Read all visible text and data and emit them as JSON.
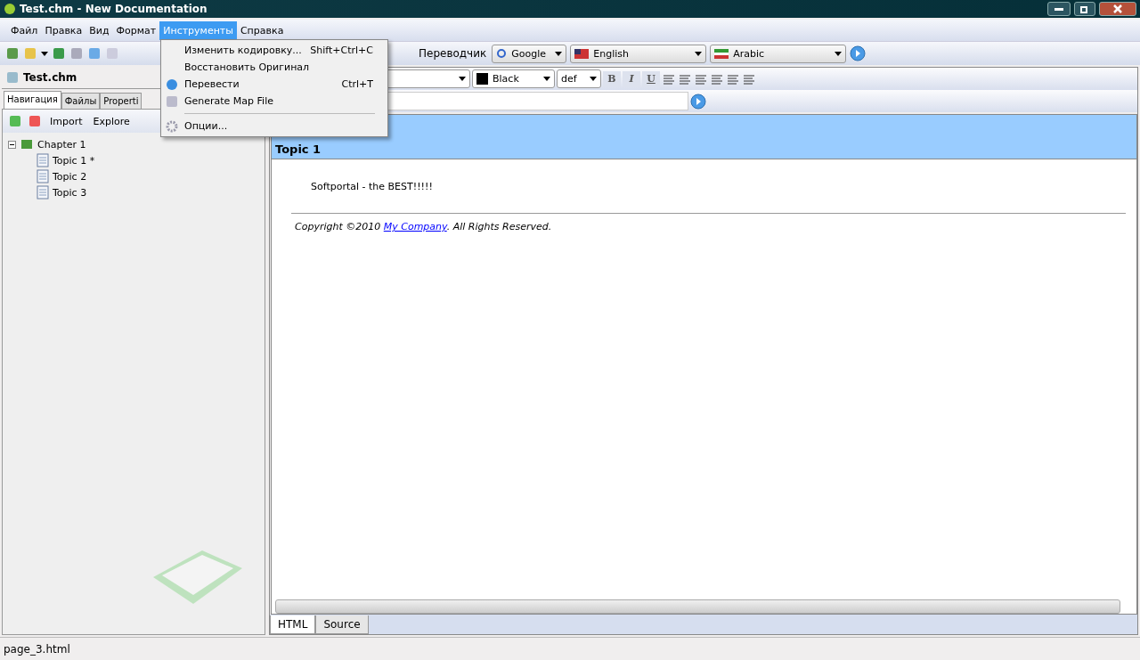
{
  "window": {
    "title": "Test.chm - New Documentation"
  },
  "menu_bar": [
    {
      "label": "Файл",
      "selected": false
    },
    {
      "label": "Правка",
      "selected": false
    },
    {
      "label": "Вид",
      "selected": false
    },
    {
      "label": "Формат",
      "selected": false
    },
    {
      "label": "Инструменты",
      "selected": true
    },
    {
      "label": "Справка",
      "selected": false
    }
  ],
  "open_menu": [
    {
      "kind": "item",
      "label": "Изменить кодировку...",
      "shortcut": "Shift+Ctrl+C"
    },
    {
      "kind": "item",
      "label": "Восстановить Оригинал"
    },
    {
      "kind": "item",
      "label": "Перевести",
      "shortcut": "Ctrl+T"
    },
    {
      "kind": "item",
      "label": "Generate Map File"
    },
    {
      "kind": "separator"
    },
    {
      "kind": "item",
      "label": "Опции..."
    }
  ],
  "translator": {
    "label": "Переводчик",
    "engine": "Google",
    "source_language": "English",
    "target_language": "Arabic"
  },
  "project_panel": {
    "title": "Test.chm",
    "tabs": [
      {
        "label": "Навигация",
        "selected": true
      },
      {
        "label": "Файлы",
        "selected": false
      },
      {
        "label": "Properti",
        "selected": false
      }
    ],
    "toolbar": [
      "Import",
      "Explore"
    ],
    "tree": [
      {
        "label": "Chapter 1",
        "expanded": true,
        "children": [
          {
            "label": "Topic 1 *"
          },
          {
            "label": "Topic 2"
          },
          {
            "label": "Topic 3"
          }
        ]
      }
    ]
  },
  "editor": {
    "font_color": {
      "label": "Black",
      "color": "#000000"
    },
    "font_size": "def",
    "format_buttons": [
      "B",
      "I",
      "U"
    ],
    "page": {
      "heading": "Topic 1",
      "body": "Softportal - the BEST!!!!!",
      "copyright_before": "Copyright ©2010 ",
      "copyright_link": "My Company",
      "copyright_after": ". All Rights Reserved."
    },
    "view_tabs": [
      {
        "label": "HTML",
        "selected": true
      },
      {
        "label": "Source",
        "selected": false
      }
    ]
  },
  "status_bar": "page_3.html"
}
